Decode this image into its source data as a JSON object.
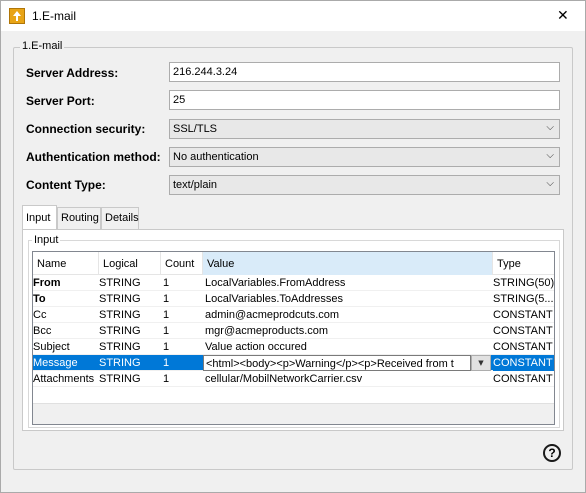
{
  "window": {
    "title": "1.E-mail",
    "close_glyph": "✕"
  },
  "group": {
    "title": "1.E-mail"
  },
  "form": {
    "server_address": {
      "label": "Server Address:",
      "value": "216.244.3.24"
    },
    "server_port": {
      "label": "Server Port:",
      "value": "25"
    },
    "connection_security": {
      "label": "Connection security:",
      "value": "SSL/TLS"
    },
    "auth_method": {
      "label": "Authentication method:",
      "value": "No authentication"
    },
    "content_type": {
      "label": "Content Type:",
      "value": "text/plain"
    }
  },
  "tabs": [
    {
      "label": "Input",
      "active": true
    },
    {
      "label": "Routing",
      "active": false
    },
    {
      "label": "Details",
      "active": false
    }
  ],
  "input_group": {
    "title": "Input"
  },
  "table": {
    "columns": [
      "Name",
      "Logical",
      "Count",
      "Value",
      "Type"
    ],
    "rows": [
      {
        "name": "From",
        "logical": "STRING",
        "count": "1",
        "value": "LocalVariables.FromAddress",
        "type": "STRING(50)",
        "bold": true
      },
      {
        "name": "To",
        "logical": "STRING",
        "count": "1",
        "value": "LocalVariables.ToAddresses",
        "type": "STRING(5...",
        "bold": true
      },
      {
        "name": "Cc",
        "logical": "STRING",
        "count": "1",
        "value": "admin@acmeprodcuts.com",
        "type": "CONSTANT",
        "bold": false
      },
      {
        "name": "Bcc",
        "logical": "STRING",
        "count": "1",
        "value": "mgr@acmeproducts.com",
        "type": "CONSTANT",
        "bold": false
      },
      {
        "name": "Subject",
        "logical": "STRING",
        "count": "1",
        "value": "Value action occured",
        "type": "CONSTANT",
        "bold": false
      },
      {
        "name": "Message",
        "logical": "STRING",
        "count": "1",
        "value": "<html><body><p>Warning</p><p>Received from t",
        "type": "CONSTANT",
        "bold": false,
        "selected": true
      },
      {
        "name": "Attachments",
        "logical": "STRING",
        "count": "1",
        "value": "cellular/MobilNetworkCarrier.csv",
        "type": "CONSTANT",
        "bold": false
      }
    ]
  },
  "help": {
    "glyph": "?"
  },
  "icons": {
    "app": "app-upload-icon",
    "close": "close-icon",
    "chevron": "chevron-down-icon",
    "help": "help-icon"
  },
  "colors": {
    "selection": "#0078d7",
    "sorted_header": "#d9ebf9"
  }
}
